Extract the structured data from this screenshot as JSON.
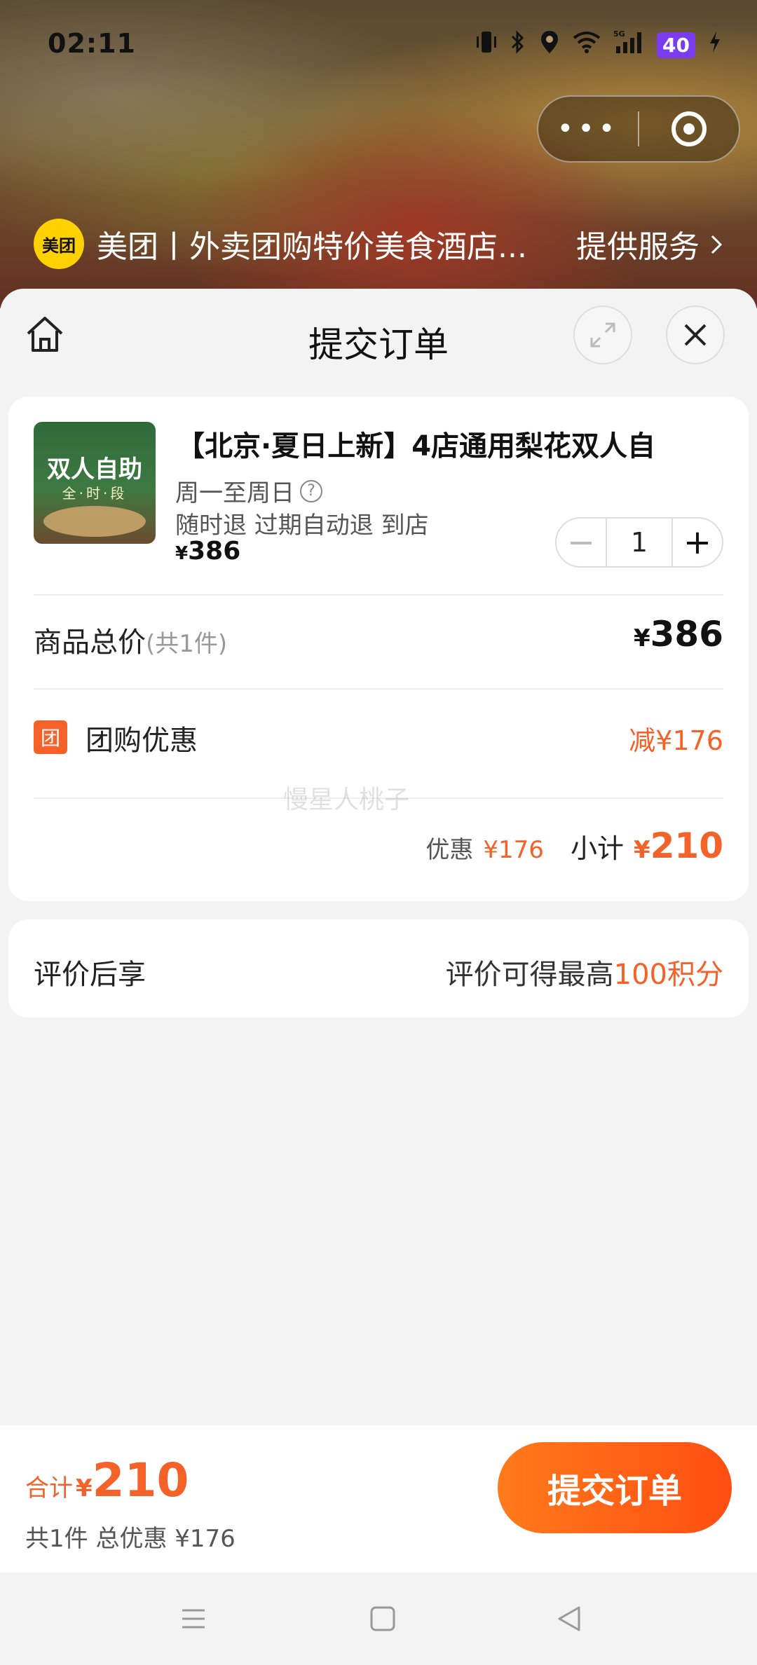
{
  "status": {
    "time": "02:11",
    "battery": "40",
    "network": "5G"
  },
  "provider": {
    "logo_text": "美团",
    "name": "美团丨外卖团购特价美食酒店...",
    "service_label": "提供服务"
  },
  "sheet": {
    "title": "提交订单"
  },
  "product": {
    "title": "【北京·夏日上新】4店通用梨花双人自",
    "image_text_main": "双人自助",
    "image_text_sub": "全·时·段",
    "availability": "周一至周日",
    "refund_policy": "随时退 过期自动退 到店",
    "price_currency": "¥",
    "price": "386",
    "quantity": "1"
  },
  "summary": {
    "total_label": "商品总价",
    "total_count": "(共1件)",
    "total_currency": "¥",
    "total_price": "386",
    "discount_icon": "团",
    "discount_label": "团购优惠",
    "discount_value": "减¥176",
    "watermark": "慢星人桃子",
    "sub_discount_label": "优惠",
    "sub_discount_value": "¥176",
    "subtotal_label": "小计",
    "subtotal_currency": "¥",
    "subtotal_value": "210"
  },
  "review": {
    "label": "评价后享",
    "text_prefix": "评价可得最高",
    "text_highlight": "100积分"
  },
  "footer": {
    "total_label": "合计",
    "total_currency": "¥",
    "total_value": "210",
    "summary_text": "共1件 总优惠 ¥176",
    "submit_label": "提交订单"
  },
  "colors": {
    "accent": "#f4622a",
    "brand_yellow": "#ffd100",
    "battery": "#7b3cf0"
  }
}
